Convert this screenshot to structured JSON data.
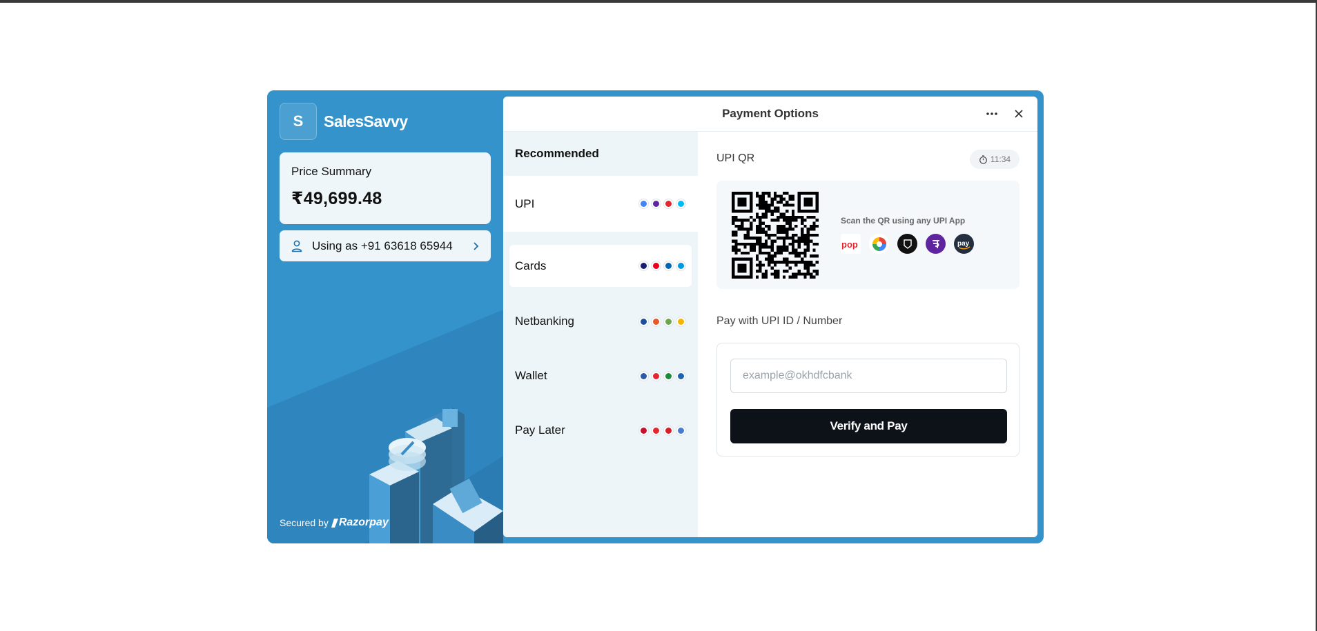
{
  "brand": {
    "logo_letter": "S",
    "name": "SalesSavvy"
  },
  "price_summary": {
    "label": "Price Summary",
    "amount": "₹49,699.48"
  },
  "user": {
    "text": "Using as +91 63618 65944"
  },
  "footer": {
    "secured_by": "Secured by",
    "provider": "Razorpay"
  },
  "header": {
    "title": "Payment Options"
  },
  "methods": [
    {
      "label": "Recommended",
      "logos": []
    },
    {
      "label": "UPI",
      "logos": [
        "#4285f4",
        "#5f259f",
        "#e3262f",
        "#00baf2"
      ]
    },
    {
      "label": "Cards",
      "logos": [
        "#1a1f71",
        "#eb001b",
        "#0066b2",
        "#0099df"
      ]
    },
    {
      "label": "Netbanking",
      "logos": [
        "#1d4e9e",
        "#e5582a",
        "#6aa84f",
        "#f4b400"
      ]
    },
    {
      "label": "Wallet",
      "logos": [
        "#2d5aa8",
        "#e3262f",
        "#1b8a3a",
        "#1e63b0"
      ]
    },
    {
      "label": "Pay Later",
      "logos": [
        "#c8102e",
        "#e3262f",
        "#d71e28",
        "#4a7bd0"
      ]
    }
  ],
  "upi_qr": {
    "title": "UPI QR",
    "timer": "11:34",
    "scan_text": "Scan the QR using any UPI App",
    "apps": [
      {
        "name": "bhim-icon",
        "label": "pop",
        "color": "#ffffff"
      },
      {
        "name": "gpay-icon",
        "label": "",
        "color": "#ffffff"
      },
      {
        "name": "cred-icon",
        "label": "CRED",
        "color": "#111111"
      },
      {
        "name": "phonepe-icon",
        "label": "पे",
        "color": "#5f259f"
      },
      {
        "name": "amazonpay-icon",
        "label": "pay",
        "color": "#232f3e"
      }
    ]
  },
  "upi_id": {
    "label": "Pay with UPI ID / Number",
    "placeholder": "example@okhdfcbank",
    "button": "Verify and Pay"
  },
  "colors": {
    "brand_blue": "#3493cb",
    "button_dark": "#0c1217"
  }
}
